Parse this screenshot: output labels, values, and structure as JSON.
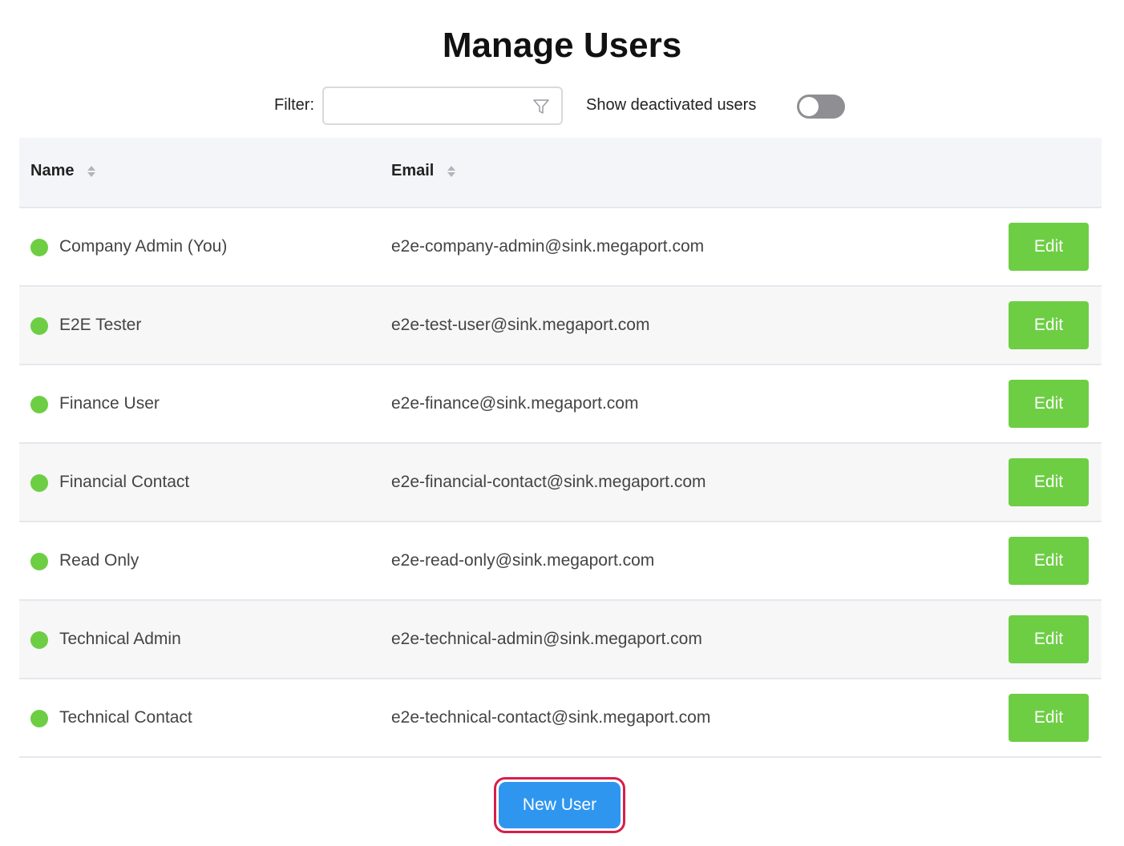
{
  "page": {
    "title": "Manage Users"
  },
  "toolbar": {
    "filter_label": "Filter:",
    "filter_value": "",
    "filter_icon": "funnel-icon",
    "show_deactivated_label": "Show deactivated users",
    "show_deactivated_on": false
  },
  "table": {
    "columns": [
      {
        "label": "Name",
        "sortable": true
      },
      {
        "label": "Email",
        "sortable": true
      }
    ],
    "rows": [
      {
        "name": "Company Admin (You)",
        "email": "e2e-company-admin@sink.megaport.com",
        "status": "active",
        "action": "Edit"
      },
      {
        "name": "E2E Tester",
        "email": "e2e-test-user@sink.megaport.com",
        "status": "active",
        "action": "Edit"
      },
      {
        "name": "Finance User",
        "email": "e2e-finance@sink.megaport.com",
        "status": "active",
        "action": "Edit"
      },
      {
        "name": "Financial Contact",
        "email": "e2e-financial-contact@sink.megaport.com",
        "status": "active",
        "action": "Edit"
      },
      {
        "name": "Read Only",
        "email": "e2e-read-only@sink.megaport.com",
        "status": "active",
        "action": "Edit"
      },
      {
        "name": "Technical Admin",
        "email": "e2e-technical-admin@sink.megaport.com",
        "status": "active",
        "action": "Edit"
      },
      {
        "name": "Technical Contact",
        "email": "e2e-technical-contact@sink.megaport.com",
        "status": "active",
        "action": "Edit"
      }
    ]
  },
  "actions": {
    "new_user_label": "New User"
  },
  "colors": {
    "status_active": "#6dce44",
    "edit_button": "#6dce44",
    "primary_button": "#2f96f0",
    "highlight_outline": "#d81e4a",
    "header_bg": "#f4f5f8"
  }
}
